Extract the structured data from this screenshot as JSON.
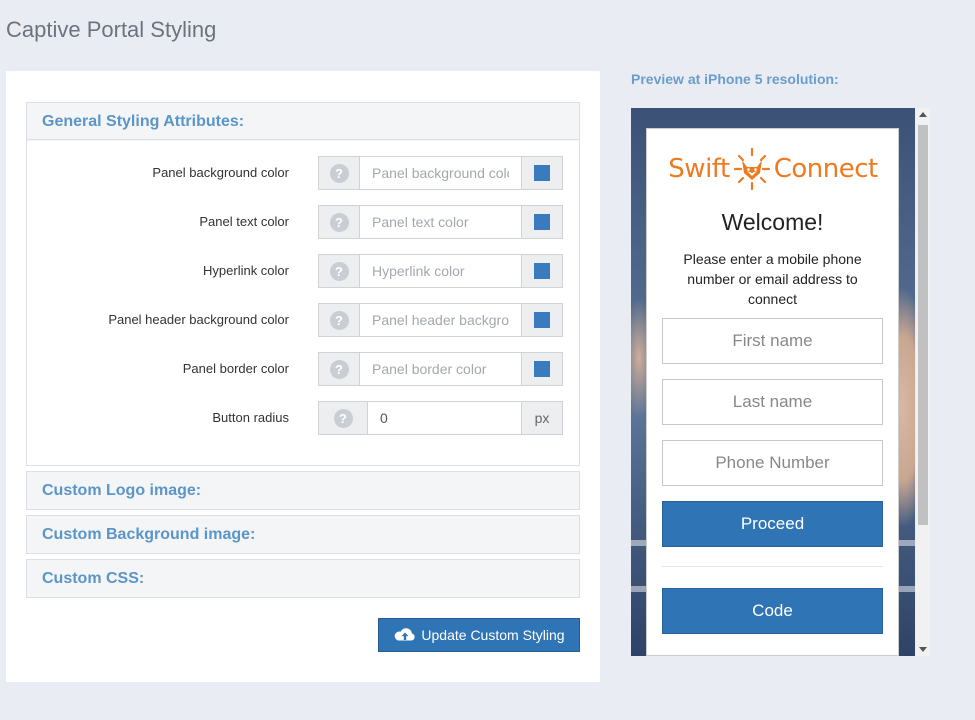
{
  "page": {
    "title": "Captive Portal Styling"
  },
  "general": {
    "title": "General Styling Attributes:",
    "rows": [
      {
        "label": "Panel background color",
        "placeholder": "Panel background color",
        "value": "",
        "swatch": "#3a7bbf"
      },
      {
        "label": "Panel text color",
        "placeholder": "Panel text color",
        "value": "",
        "swatch": "#3a7bbf"
      },
      {
        "label": "Hyperlink color",
        "placeholder": "Hyperlink color",
        "value": "",
        "swatch": "#3a7bbf"
      },
      {
        "label": "Panel header background color",
        "placeholder": "Panel header background color",
        "value": "",
        "swatch": "#3a7bbf"
      },
      {
        "label": "Panel border color",
        "placeholder": "Panel border color",
        "value": "",
        "swatch": "#3a7bbf"
      }
    ],
    "radius": {
      "label": "Button radius",
      "value": "0",
      "unit": "px"
    },
    "help_glyph": "?"
  },
  "sections": {
    "logo": "Custom Logo image:",
    "background": "Custom Background image:",
    "css": "Custom CSS:"
  },
  "update_button": {
    "label": "Update Custom Styling",
    "icon": "cloud-upload-icon"
  },
  "preview": {
    "label": "Preview at iPhone 5 resolution:",
    "logo_left": "Swift",
    "logo_right": "Connect",
    "welcome": "Welcome!",
    "instructions": "Please enter a mobile phone number or email address to connect",
    "first_name_placeholder": "First name",
    "last_name_placeholder": "Last name",
    "phone_placeholder": "Phone Number",
    "proceed_label": "Proceed",
    "code_label": "Code"
  },
  "colors": {
    "accent": "#2f74b5",
    "section_title": "#5b95c9",
    "logo_orange": "#ee7a22"
  }
}
